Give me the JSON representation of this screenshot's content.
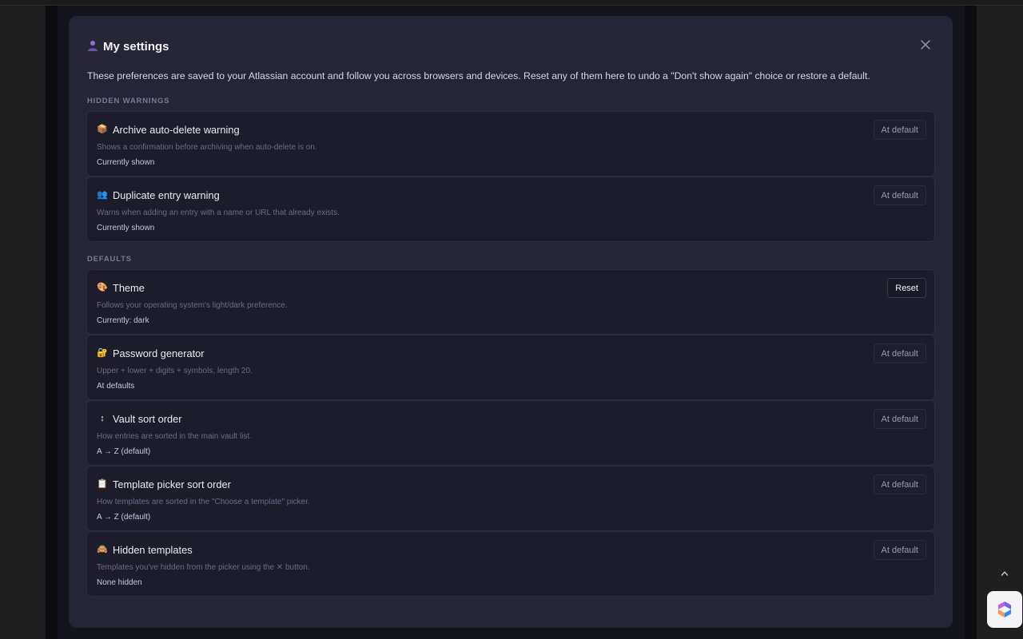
{
  "modal": {
    "title": "My settings",
    "header_icon": "user-icon",
    "close_icon": "close-icon",
    "intro": "These preferences are saved to your Atlassian account and follow you across browsers and devices. Reset any of them here to undo a \"Don't show again\" choice or restore a default."
  },
  "sections": {
    "hidden_warnings": "HIDDEN WARNINGS",
    "defaults": "DEFAULTS"
  },
  "cards": {
    "archive": {
      "icon": "📦",
      "title": "Archive auto-delete warning",
      "description": "Shows a confirmation before archiving when auto-delete is on.",
      "status": "Currently shown",
      "button": "At default"
    },
    "duplicate": {
      "icon": "👥",
      "title": "Duplicate entry warning",
      "description": "Warns when adding an entry with a name or URL that already exists.",
      "status": "Currently shown",
      "button": "At default"
    },
    "theme": {
      "icon": "🎨",
      "title": "Theme",
      "description": "Follows your operating system's light/dark preference.",
      "status": "Currently: dark",
      "button": "Reset"
    },
    "password": {
      "icon": "🔐",
      "title": "Password generator",
      "description": "Upper + lower + digits + symbols, length 20.",
      "status": "At defaults",
      "button": "At default"
    },
    "vault_sort": {
      "icon": "↕",
      "title": "Vault sort order",
      "description": "How entries are sorted in the main vault list.",
      "status": "A → Z (default)",
      "button": "At default"
    },
    "template_sort": {
      "icon": "📋",
      "title": "Template picker sort order",
      "description": "How templates are sorted in the \"Choose a template\" picker.",
      "status": "A → Z (default)",
      "button": "At default"
    },
    "hidden_templates": {
      "icon": "🙈",
      "title": "Hidden templates",
      "description": "Templates you've hidden from the picker using the ✕ button.",
      "status": "None hidden",
      "button": "At default"
    }
  },
  "chrome": {
    "scroll_up_icon": "chevron-up-icon",
    "corner_widget_icon": "app-logo-icon",
    "accent": "#8f6fd6"
  }
}
